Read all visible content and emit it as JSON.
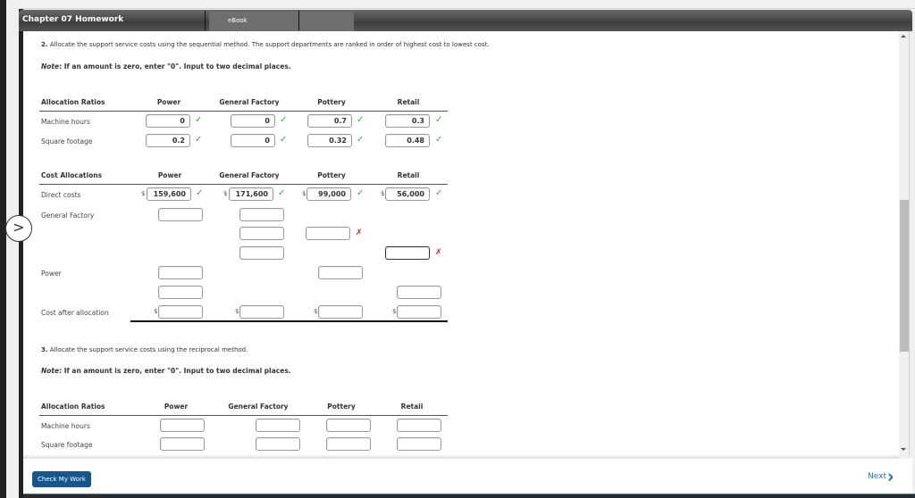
{
  "header": {
    "title": "Chapter 07 Homework",
    "tabs": [
      {
        "label": "eBook"
      }
    ]
  },
  "q2": {
    "number": "2.",
    "text": "Allocate the support service costs using the sequential method. The support departments are ranked in order of highest cost to lowest cost.",
    "note_label": "Note",
    "note_text": ": If an amount is zero, enter \"0\". Input to two decimal places.",
    "ratios": {
      "headers": [
        "Allocation Ratios",
        "Power",
        "General Factory",
        "Pottery",
        "Retail"
      ],
      "rows": [
        {
          "label": "Machine hours",
          "values": [
            "0",
            "0",
            "0.7",
            "0.3"
          ],
          "status": [
            "correct",
            "correct",
            "correct",
            "correct"
          ]
        },
        {
          "label": "Square footage",
          "values": [
            "0.2",
            "0",
            "0.32",
            "0.48"
          ],
          "status": [
            "correct",
            "correct",
            "correct",
            "correct"
          ]
        }
      ]
    },
    "costs": {
      "headers": [
        "Cost Allocations",
        "Power",
        "General Factory",
        "Pottery",
        "Retail"
      ],
      "currency": "$",
      "direct_costs": {
        "label": "Direct costs",
        "values": [
          "159,600",
          "171,600",
          "99,000",
          "56,000"
        ],
        "status": [
          "correct",
          "correct",
          "correct",
          "correct"
        ]
      },
      "general_factory_label": "General Factory",
      "power_label": "Power",
      "cost_after_label": "Cost after allocation",
      "incorrect_fields": [
        "pottery-general-factory",
        "retail-general-factory"
      ]
    }
  },
  "q3": {
    "number": "3.",
    "text": "Allocate the support service costs using the reciprocal method.",
    "note_label": "Note",
    "note_text": ": If an amount is zero, enter \"0\". Input to two decimal places.",
    "ratios": {
      "headers": [
        "Allocation Ratios",
        "Power",
        "General Factory",
        "Pottery",
        "Retail"
      ],
      "rows": [
        {
          "label": "Machine hours",
          "values": [
            "",
            "",
            "",
            ""
          ]
        },
        {
          "label": "Square footage",
          "values": [
            "",
            "",
            "",
            ""
          ]
        }
      ]
    }
  },
  "marks": {
    "check": "✓",
    "cross": "✗"
  },
  "footer": {
    "check_button": "Check My Work",
    "next_label": "Next",
    "next_icon": "›"
  },
  "colors": {
    "correct": "#3aa93a",
    "incorrect": "#e02020",
    "button": "#14578f",
    "link": "#1e6fc8"
  }
}
